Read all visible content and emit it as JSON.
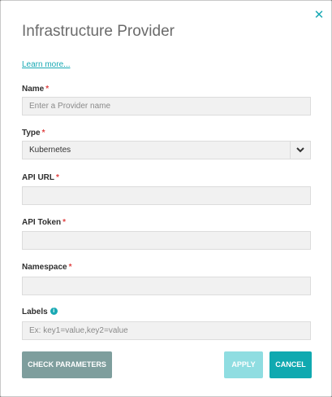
{
  "dialog": {
    "title": "Infrastructure Provider",
    "close_icon": "close-icon",
    "learn_more": "Learn more..."
  },
  "fields": {
    "name": {
      "label": "Name",
      "required": "*",
      "value": "",
      "placeholder": "Enter a Provider name"
    },
    "type": {
      "label": "Type",
      "required": "*",
      "value": "Kubernetes",
      "caret_icon": "chevron-down-icon"
    },
    "api_url": {
      "label": "API URL",
      "required": "*",
      "value": ""
    },
    "api_token": {
      "label": "API Token",
      "required": "*",
      "value": ""
    },
    "namespace": {
      "label": "Namespace",
      "required": "*",
      "value": ""
    },
    "labels": {
      "label": "Labels",
      "info_icon": "info-icon",
      "value": "",
      "placeholder": "Ex: key1=value,key2=value"
    }
  },
  "buttons": {
    "check_parameters": "CHECK PARAMETERS",
    "apply": "APPLY",
    "cancel": "CANCEL"
  },
  "colors": {
    "accent": "#19a9b4",
    "required": "#e04343",
    "check_button": "#7e9e9d",
    "apply_button_disabled": "#8fdde1",
    "cancel_button": "#10a9b0"
  }
}
